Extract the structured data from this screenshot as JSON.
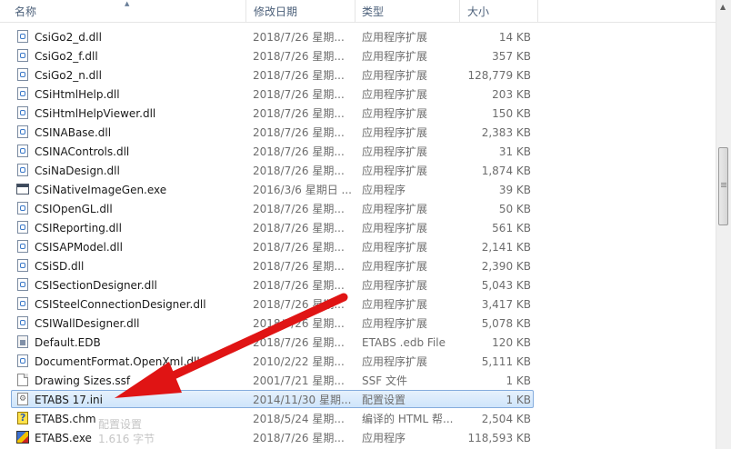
{
  "columns": {
    "name": "名称",
    "date": "修改日期",
    "type": "类型",
    "size": "大小"
  },
  "files": [
    {
      "name": "CsiGo2_d.dll",
      "date": "2018/7/26 星期...",
      "type": "应用程序扩展",
      "size": "14 KB",
      "icon": "dll-file-icon"
    },
    {
      "name": "CsiGo2_f.dll",
      "date": "2018/7/26 星期...",
      "type": "应用程序扩展",
      "size": "357 KB",
      "icon": "dll-file-icon"
    },
    {
      "name": "CsiGo2_n.dll",
      "date": "2018/7/26 星期...",
      "type": "应用程序扩展",
      "size": "128,779 KB",
      "icon": "dll-file-icon"
    },
    {
      "name": "CSiHtmlHelp.dll",
      "date": "2018/7/26 星期...",
      "type": "应用程序扩展",
      "size": "203 KB",
      "icon": "dll-file-icon"
    },
    {
      "name": "CSiHtmlHelpViewer.dll",
      "date": "2018/7/26 星期...",
      "type": "应用程序扩展",
      "size": "150 KB",
      "icon": "dll-file-icon"
    },
    {
      "name": "CSINABase.dll",
      "date": "2018/7/26 星期...",
      "type": "应用程序扩展",
      "size": "2,383 KB",
      "icon": "dll-file-icon"
    },
    {
      "name": "CSINAControls.dll",
      "date": "2018/7/26 星期...",
      "type": "应用程序扩展",
      "size": "31 KB",
      "icon": "dll-file-icon"
    },
    {
      "name": "CsiNaDesign.dll",
      "date": "2018/7/26 星期...",
      "type": "应用程序扩展",
      "size": "1,874 KB",
      "icon": "dll-file-icon"
    },
    {
      "name": "CSiNativeImageGen.exe",
      "date": "2016/3/6 星期日 ...",
      "type": "应用程序",
      "size": "39 KB",
      "icon": "exe-window-icon"
    },
    {
      "name": "CSIOpenGL.dll",
      "date": "2018/7/26 星期...",
      "type": "应用程序扩展",
      "size": "50 KB",
      "icon": "dll-file-icon"
    },
    {
      "name": "CSIReporting.dll",
      "date": "2018/7/26 星期...",
      "type": "应用程序扩展",
      "size": "561 KB",
      "icon": "dll-file-icon"
    },
    {
      "name": "CSISAPModel.dll",
      "date": "2018/7/26 星期...",
      "type": "应用程序扩展",
      "size": "2,141 KB",
      "icon": "dll-file-icon"
    },
    {
      "name": "CSiSD.dll",
      "date": "2018/7/26 星期...",
      "type": "应用程序扩展",
      "size": "2,390 KB",
      "icon": "dll-file-icon"
    },
    {
      "name": "CSISectionDesigner.dll",
      "date": "2018/7/26 星期...",
      "type": "应用程序扩展",
      "size": "5,043 KB",
      "icon": "dll-file-icon"
    },
    {
      "name": "CSISteelConnectionDesigner.dll",
      "date": "2018/7/26 星期...",
      "type": "应用程序扩展",
      "size": "3,417 KB",
      "icon": "dll-file-icon"
    },
    {
      "name": "CSIWallDesigner.dll",
      "date": "2018/7/26 星期...",
      "type": "应用程序扩展",
      "size": "5,078 KB",
      "icon": "dll-file-icon"
    },
    {
      "name": "Default.EDB",
      "date": "2018/7/26 星期...",
      "type": "ETABS .edb File",
      "size": "120 KB",
      "icon": "edb-file-icon"
    },
    {
      "name": "DocumentFormat.OpenXml.dll",
      "date": "2010/2/22 星期...",
      "type": "应用程序扩展",
      "size": "5,111 KB",
      "icon": "dll-file-icon"
    },
    {
      "name": "Drawing Sizes.ssf",
      "date": "2001/7/21 星期...",
      "type": "SSF 文件",
      "size": "1 KB",
      "icon": "generic-file-icon"
    },
    {
      "name": "ETABS 17.ini",
      "date": "2014/11/30 星期...",
      "type": "配置设置",
      "size": "1 KB",
      "icon": "ini-settings-icon",
      "selected": true
    },
    {
      "name": "ETABS.chm",
      "date": "2018/5/24 星期...",
      "type": "编译的 HTML 帮...",
      "size": "2,504 KB",
      "icon": "chm-help-icon"
    },
    {
      "name": "ETABS.exe",
      "date": "2018/7/26 星期...",
      "type": "应用程序",
      "size": "118,593 KB",
      "icon": "etabs-app-icon"
    }
  ],
  "watermark": {
    "line1": "配置设置",
    "line2": "1.616 字节"
  },
  "colors": {
    "header_text": "#4c607a",
    "selection_border": "#84acdd",
    "arrow": "#e01414"
  }
}
